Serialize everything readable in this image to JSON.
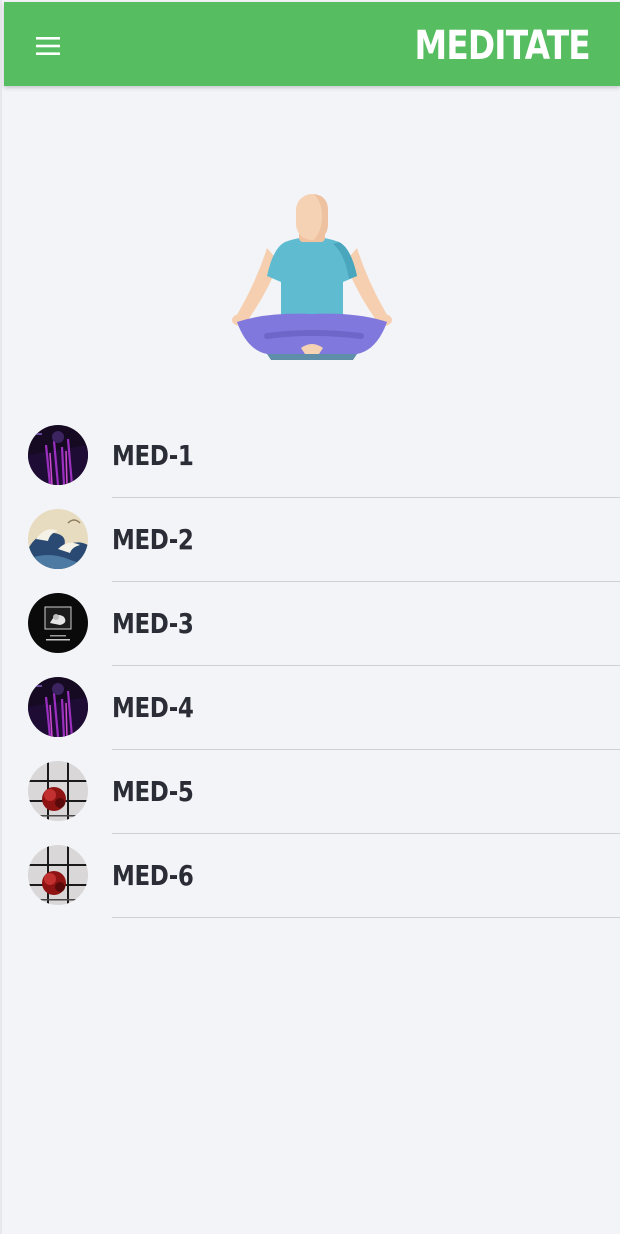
{
  "appbar": {
    "title": "MEDITATE",
    "menu_icon": "hamburger-menu-icon",
    "color": "#56bd61"
  },
  "hero": {
    "icon": "meditation-figure-icon"
  },
  "meditations": [
    {
      "label": "MED-1",
      "thumbnail": "purple-neon-art"
    },
    {
      "label": "MED-2",
      "thumbnail": "great-wave-art"
    },
    {
      "label": "MED-3",
      "thumbnail": "dark-album-art"
    },
    {
      "label": "MED-4",
      "thumbnail": "purple-neon-art"
    },
    {
      "label": "MED-5",
      "thumbnail": "red-flower-grid-art"
    },
    {
      "label": "MED-6",
      "thumbnail": "red-flower-grid-art"
    }
  ]
}
